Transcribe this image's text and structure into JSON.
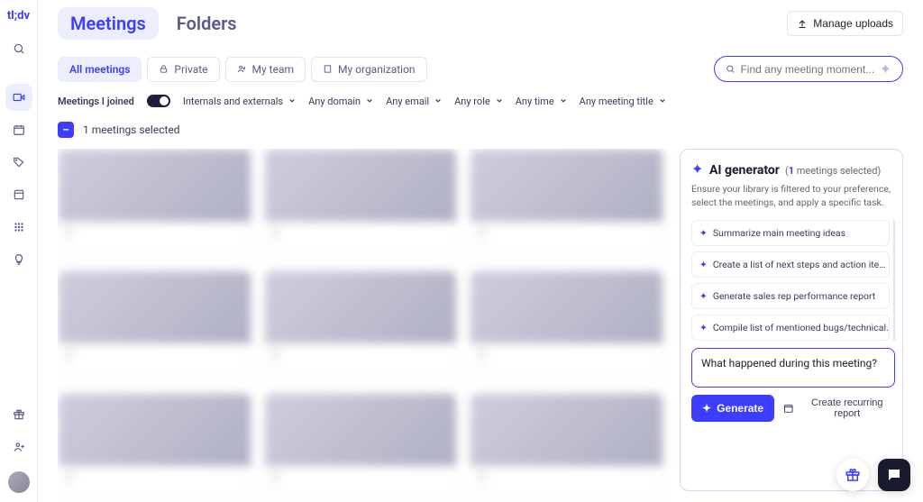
{
  "brand": "tl;dv",
  "tabs": {
    "meetings": "Meetings",
    "folders": "Folders"
  },
  "manage_uploads": "Manage uploads",
  "scope": {
    "all": "All meetings",
    "private": "Private",
    "team": "My team",
    "org": "My organization"
  },
  "search": {
    "placeholder": "Find any meeting moment..."
  },
  "filters": {
    "joined_label": "Meetings I joined",
    "internals": "Internals and externals",
    "domain": "Any domain",
    "email": "Any email",
    "role": "Any role",
    "time": "Any time",
    "title": "Any meeting title"
  },
  "selection": {
    "count_label": "1 meetings selected"
  },
  "cards": [
    {
      "title": "—",
      "sub": "—"
    },
    {
      "title": "—",
      "sub": "—"
    },
    {
      "title": "—",
      "sub": "—"
    },
    {
      "title": "—",
      "sub": "—"
    },
    {
      "title": "—",
      "sub": "—"
    },
    {
      "title": "—",
      "sub": "—"
    },
    {
      "title": "—",
      "sub": "—"
    },
    {
      "title": "—",
      "sub": "—"
    },
    {
      "title": "—",
      "sub": "—"
    }
  ],
  "ai": {
    "title": "AI generator",
    "count_prefix": "(",
    "count_num": "1",
    "count_suffix": " meetings selected)",
    "desc": "Ensure your library is filtered to your preference, select the meetings, and apply a specific task.",
    "suggestions": [
      "Summarize main meeting ideas",
      "Create a list of next steps and action ite…",
      "Generate sales rep performance report",
      "Compile list of mentioned bugs/technical…"
    ],
    "prompt_value": "What happened during this meeting?",
    "generate": "Generate",
    "recurring": "Create recurring report"
  }
}
